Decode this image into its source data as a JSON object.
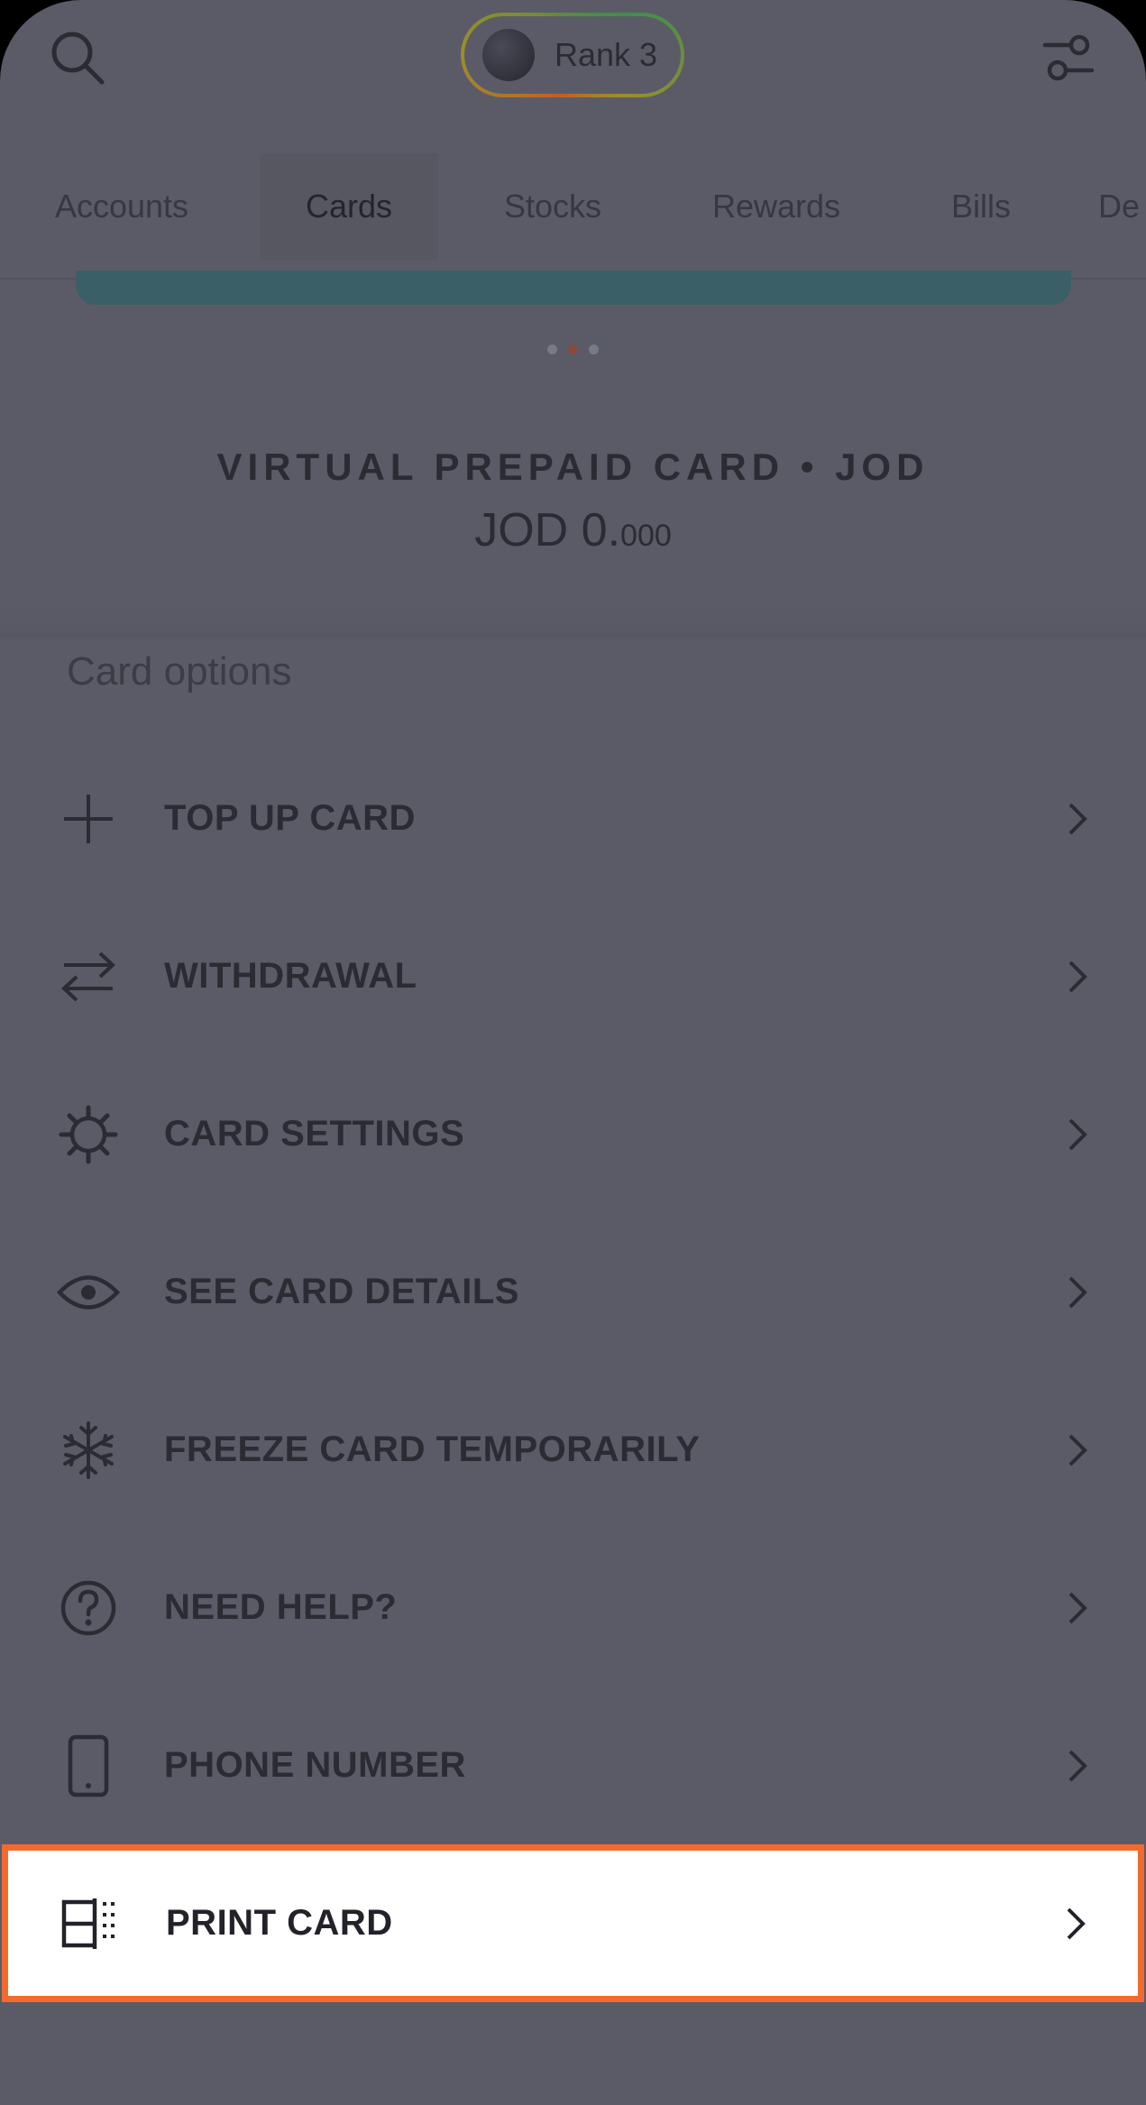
{
  "header": {
    "rank_label": "Rank 3",
    "icons": {
      "search": "search-icon",
      "filter": "filter-icon"
    }
  },
  "tabs": [
    {
      "label": "Accounts",
      "active": false
    },
    {
      "label": "Cards",
      "active": true
    },
    {
      "label": "Stocks",
      "active": false
    },
    {
      "label": "Rewards",
      "active": false
    },
    {
      "label": "Bills",
      "active": false
    },
    {
      "label": "De",
      "active": false
    }
  ],
  "carousel": {
    "dot_count": 3,
    "active_index": 1
  },
  "card": {
    "title": "VIRTUAL PREPAID CARD  •  JOD",
    "balance_main": "JOD 0.",
    "balance_decimals": "000"
  },
  "options": {
    "section_title": "Card options",
    "items": [
      {
        "label": "TOP UP CARD",
        "icon": "plus-icon"
      },
      {
        "label": "WITHDRAWAL",
        "icon": "transfer-arrows-icon"
      },
      {
        "label": "CARD SETTINGS",
        "icon": "gear-icon"
      },
      {
        "label": "SEE CARD DETAILS",
        "icon": "eye-icon"
      },
      {
        "label": "FREEZE CARD TEMPORARILY",
        "icon": "snowflake-icon"
      },
      {
        "label": "NEED HELP?",
        "icon": "question-circle-icon"
      },
      {
        "label": "PHONE NUMBER",
        "icon": "phone-icon"
      },
      {
        "label": "PRINT CARD",
        "icon": "print-card-icon",
        "highlighted": true
      }
    ]
  },
  "colors": {
    "overlay_bg": "#5b5b67",
    "highlight_border": "#f36a2f",
    "highlight_bg": "#ffffff",
    "card_strip": "#3a5f66"
  }
}
